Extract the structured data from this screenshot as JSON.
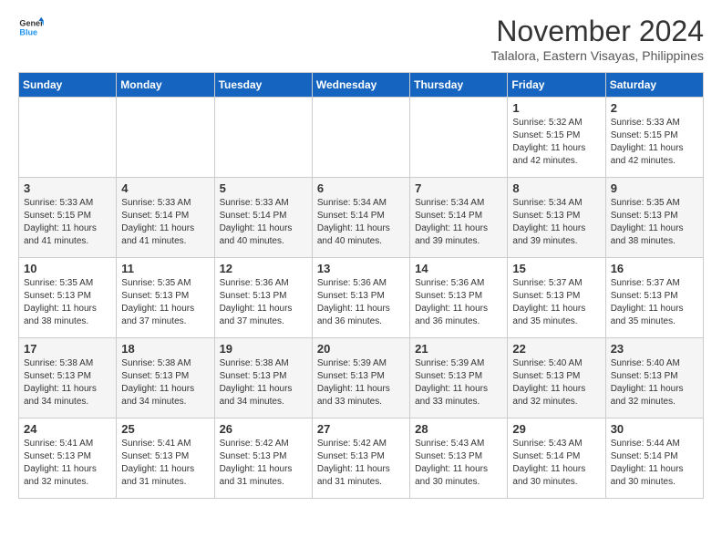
{
  "logo": {
    "line1": "General",
    "line2": "Blue"
  },
  "title": "November 2024",
  "location": "Talalora, Eastern Visayas, Philippines",
  "days_of_week": [
    "Sunday",
    "Monday",
    "Tuesday",
    "Wednesday",
    "Thursday",
    "Friday",
    "Saturday"
  ],
  "weeks": [
    [
      {
        "day": "",
        "info": ""
      },
      {
        "day": "",
        "info": ""
      },
      {
        "day": "",
        "info": ""
      },
      {
        "day": "",
        "info": ""
      },
      {
        "day": "",
        "info": ""
      },
      {
        "day": "1",
        "info": "Sunrise: 5:32 AM\nSunset: 5:15 PM\nDaylight: 11 hours and 42 minutes."
      },
      {
        "day": "2",
        "info": "Sunrise: 5:33 AM\nSunset: 5:15 PM\nDaylight: 11 hours and 42 minutes."
      }
    ],
    [
      {
        "day": "3",
        "info": "Sunrise: 5:33 AM\nSunset: 5:15 PM\nDaylight: 11 hours and 41 minutes."
      },
      {
        "day": "4",
        "info": "Sunrise: 5:33 AM\nSunset: 5:14 PM\nDaylight: 11 hours and 41 minutes."
      },
      {
        "day": "5",
        "info": "Sunrise: 5:33 AM\nSunset: 5:14 PM\nDaylight: 11 hours and 40 minutes."
      },
      {
        "day": "6",
        "info": "Sunrise: 5:34 AM\nSunset: 5:14 PM\nDaylight: 11 hours and 40 minutes."
      },
      {
        "day": "7",
        "info": "Sunrise: 5:34 AM\nSunset: 5:14 PM\nDaylight: 11 hours and 39 minutes."
      },
      {
        "day": "8",
        "info": "Sunrise: 5:34 AM\nSunset: 5:13 PM\nDaylight: 11 hours and 39 minutes."
      },
      {
        "day": "9",
        "info": "Sunrise: 5:35 AM\nSunset: 5:13 PM\nDaylight: 11 hours and 38 minutes."
      }
    ],
    [
      {
        "day": "10",
        "info": "Sunrise: 5:35 AM\nSunset: 5:13 PM\nDaylight: 11 hours and 38 minutes."
      },
      {
        "day": "11",
        "info": "Sunrise: 5:35 AM\nSunset: 5:13 PM\nDaylight: 11 hours and 37 minutes."
      },
      {
        "day": "12",
        "info": "Sunrise: 5:36 AM\nSunset: 5:13 PM\nDaylight: 11 hours and 37 minutes."
      },
      {
        "day": "13",
        "info": "Sunrise: 5:36 AM\nSunset: 5:13 PM\nDaylight: 11 hours and 36 minutes."
      },
      {
        "day": "14",
        "info": "Sunrise: 5:36 AM\nSunset: 5:13 PM\nDaylight: 11 hours and 36 minutes."
      },
      {
        "day": "15",
        "info": "Sunrise: 5:37 AM\nSunset: 5:13 PM\nDaylight: 11 hours and 35 minutes."
      },
      {
        "day": "16",
        "info": "Sunrise: 5:37 AM\nSunset: 5:13 PM\nDaylight: 11 hours and 35 minutes."
      }
    ],
    [
      {
        "day": "17",
        "info": "Sunrise: 5:38 AM\nSunset: 5:13 PM\nDaylight: 11 hours and 34 minutes."
      },
      {
        "day": "18",
        "info": "Sunrise: 5:38 AM\nSunset: 5:13 PM\nDaylight: 11 hours and 34 minutes."
      },
      {
        "day": "19",
        "info": "Sunrise: 5:38 AM\nSunset: 5:13 PM\nDaylight: 11 hours and 34 minutes."
      },
      {
        "day": "20",
        "info": "Sunrise: 5:39 AM\nSunset: 5:13 PM\nDaylight: 11 hours and 33 minutes."
      },
      {
        "day": "21",
        "info": "Sunrise: 5:39 AM\nSunset: 5:13 PM\nDaylight: 11 hours and 33 minutes."
      },
      {
        "day": "22",
        "info": "Sunrise: 5:40 AM\nSunset: 5:13 PM\nDaylight: 11 hours and 32 minutes."
      },
      {
        "day": "23",
        "info": "Sunrise: 5:40 AM\nSunset: 5:13 PM\nDaylight: 11 hours and 32 minutes."
      }
    ],
    [
      {
        "day": "24",
        "info": "Sunrise: 5:41 AM\nSunset: 5:13 PM\nDaylight: 11 hours and 32 minutes."
      },
      {
        "day": "25",
        "info": "Sunrise: 5:41 AM\nSunset: 5:13 PM\nDaylight: 11 hours and 31 minutes."
      },
      {
        "day": "26",
        "info": "Sunrise: 5:42 AM\nSunset: 5:13 PM\nDaylight: 11 hours and 31 minutes."
      },
      {
        "day": "27",
        "info": "Sunrise: 5:42 AM\nSunset: 5:13 PM\nDaylight: 11 hours and 31 minutes."
      },
      {
        "day": "28",
        "info": "Sunrise: 5:43 AM\nSunset: 5:13 PM\nDaylight: 11 hours and 30 minutes."
      },
      {
        "day": "29",
        "info": "Sunrise: 5:43 AM\nSunset: 5:14 PM\nDaylight: 11 hours and 30 minutes."
      },
      {
        "day": "30",
        "info": "Sunrise: 5:44 AM\nSunset: 5:14 PM\nDaylight: 11 hours and 30 minutes."
      }
    ]
  ]
}
